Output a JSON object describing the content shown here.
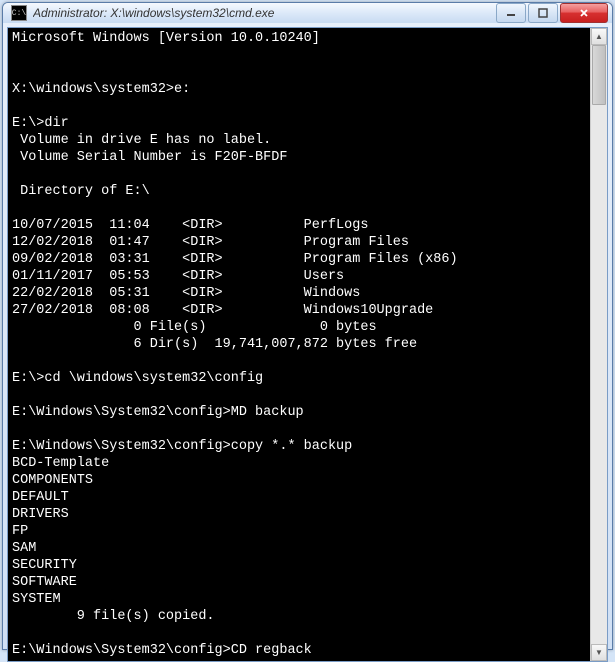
{
  "window": {
    "title": "Administrator: X:\\windows\\system32\\cmd.exe",
    "icon_glyph": "C:\\"
  },
  "terminal": {
    "lines": [
      "Microsoft Windows [Version 10.0.10240]",
      "",
      "",
      "X:\\windows\\system32>e:",
      "",
      "E:\\>dir",
      " Volume in drive E has no label.",
      " Volume Serial Number is F20F-BFDF",
      "",
      " Directory of E:\\",
      "",
      "10/07/2015  11:04    <DIR>          PerfLogs",
      "12/02/2018  01:47    <DIR>          Program Files",
      "09/02/2018  03:31    <DIR>          Program Files (x86)",
      "01/11/2017  05:53    <DIR>          Users",
      "22/02/2018  05:31    <DIR>          Windows",
      "27/02/2018  08:08    <DIR>          Windows10Upgrade",
      "               0 File(s)              0 bytes",
      "               6 Dir(s)  19,741,007,872 bytes free",
      "",
      "E:\\>cd \\windows\\system32\\config",
      "",
      "E:\\Windows\\System32\\config>MD backup",
      "",
      "E:\\Windows\\System32\\config>copy *.* backup",
      "BCD-Template",
      "COMPONENTS",
      "DEFAULT",
      "DRIVERS",
      "FP",
      "SAM",
      "SECURITY",
      "SOFTWARE",
      "SYSTEM",
      "        9 file(s) copied.",
      "",
      "E:\\Windows\\System32\\config>CD regback"
    ]
  }
}
